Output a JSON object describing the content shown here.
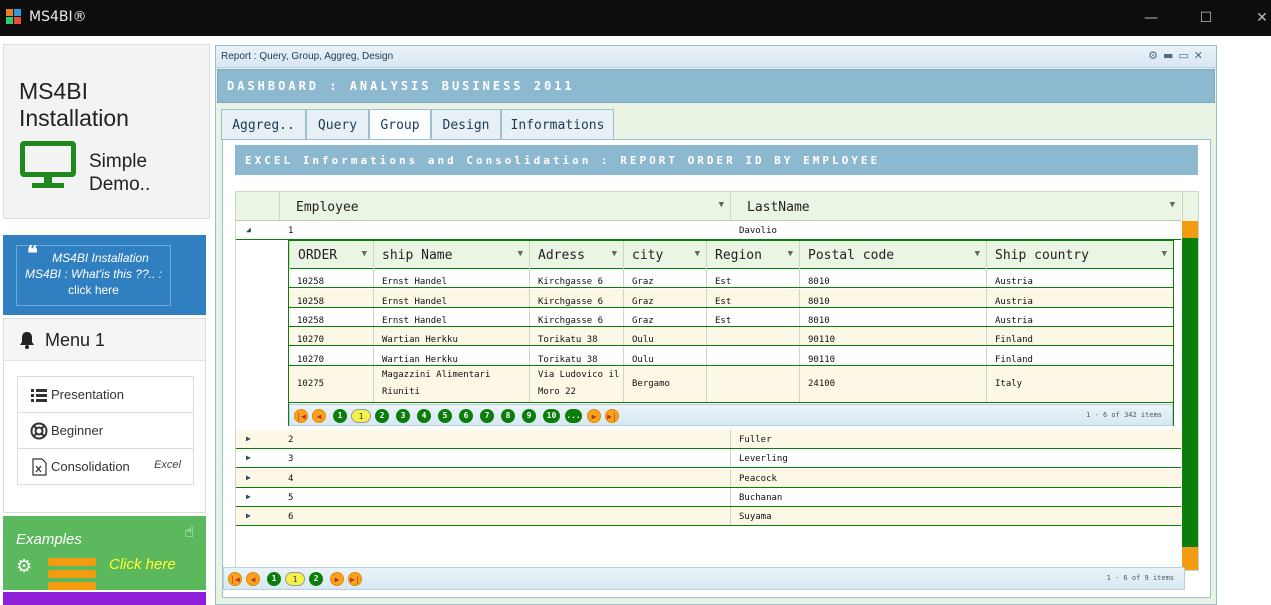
{
  "app": {
    "title": "MS4BI®"
  },
  "window": {
    "minimize": "—",
    "maximize": "☐",
    "close": "✕"
  },
  "sidebar": {
    "install_title_line1": "MS4BI",
    "install_title_line2": "Installation",
    "simple_line1": "Simple",
    "simple_line2": "Demo..",
    "info_line1": "MS4BI Installation",
    "info_line2": "MS4BI : What'is this ??.. :",
    "info_click": "click here",
    "menu_title": "Menu 1",
    "menu_items": [
      {
        "label": "Presentation",
        "extra": ""
      },
      {
        "label": "Beginner",
        "extra": ""
      },
      {
        "label": "Consolidation",
        "extra": "Excel"
      }
    ],
    "examples_title": "Examples",
    "examples_click": "Click here"
  },
  "report": {
    "window_title": "Report : Query, Group, Aggreg, Design",
    "dashboard_title": "DASHBOARD : ANALYSIS BUSINESS 2011",
    "tabs": [
      "Aggreg..",
      "Query",
      "Group",
      "Design",
      "Informations"
    ],
    "active_tab": "Group",
    "excel_title": "EXCEL Informations and Consolidation : REPORT ORDER ID BY EMPLOYEE",
    "grid_headers": [
      "Employee",
      "LastName"
    ],
    "detail_headers": [
      "ORDER",
      "ship Name",
      "Adress",
      "city",
      "Region",
      "Postal code",
      "Ship country"
    ],
    "detail_rows": [
      [
        "10258",
        "Ernst Handel",
        "Kirchgasse 6",
        "Graz",
        "Est",
        "8010",
        "Austria"
      ],
      [
        "10258",
        "Ernst Handel",
        "Kirchgasse 6",
        "Graz",
        "Est",
        "8010",
        "Austria"
      ],
      [
        "10258",
        "Ernst Handel",
        "Kirchgasse 6",
        "Graz",
        "Est",
        "8010",
        "Austria"
      ],
      [
        "10270",
        "Wartian Herkku",
        "Torikatu 38",
        "Oulu",
        "",
        "90110",
        "Finland"
      ],
      [
        "10270",
        "Wartian Herkku",
        "Torikatu 38",
        "Oulu",
        "",
        "90110",
        "Finland"
      ],
      [
        "10275",
        "Magazzini Alimentari Riuniti",
        "Via Ludovico il Moro 22",
        "Bergamo",
        "",
        "24100",
        "Italy"
      ]
    ],
    "detail_pager_pages": [
      "1",
      "1",
      "2",
      "3",
      "4",
      "5",
      "6",
      "7",
      "8",
      "9",
      "10",
      "..."
    ],
    "detail_pager_info": "1 - 6 of 342 items",
    "employees": [
      {
        "id": "1",
        "lastname": "Davolio"
      },
      {
        "id": "2",
        "lastname": "Fuller"
      },
      {
        "id": "3",
        "lastname": "Leverling"
      },
      {
        "id": "4",
        "lastname": "Peacock"
      },
      {
        "id": "5",
        "lastname": "Buchanan"
      },
      {
        "id": "6",
        "lastname": "Suyama"
      }
    ],
    "main_pager_pages": [
      "1",
      "1",
      "2"
    ],
    "main_pager_info": "1 - 6 of 9 items"
  },
  "colors": {
    "accent_green": "#0b7d0b",
    "orange": "#f39c12",
    "steel_blue": "#8cb8d0"
  }
}
